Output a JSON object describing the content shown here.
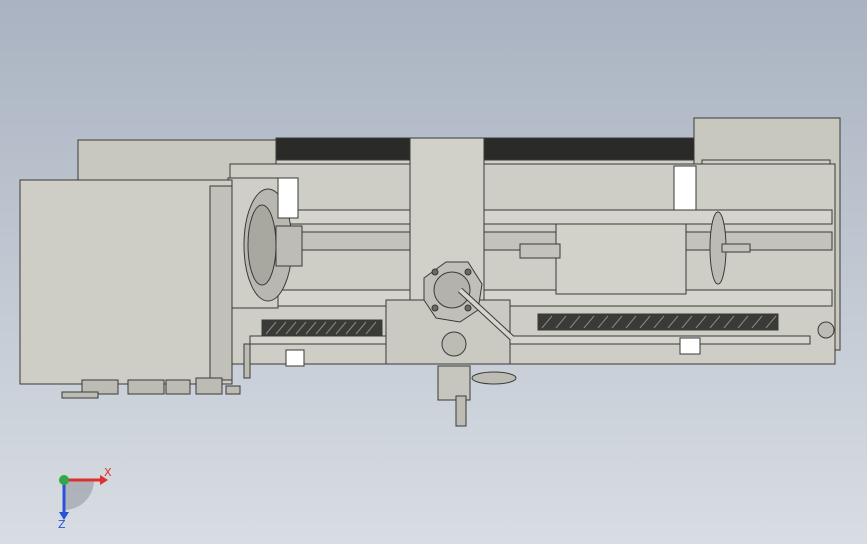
{
  "viewport": {
    "background_top": "#a9b3c1",
    "background_bottom": "#d8dde3",
    "model_body_color": "#c9c8bf",
    "model_edge_color": "#3a3a36",
    "model_dark_color": "#2a2a28"
  },
  "triad": {
    "x_label": "X",
    "z_label": "Z",
    "x_color": "#e0302a",
    "y_color": "#2fa84a",
    "z_color": "#2a52d8"
  }
}
